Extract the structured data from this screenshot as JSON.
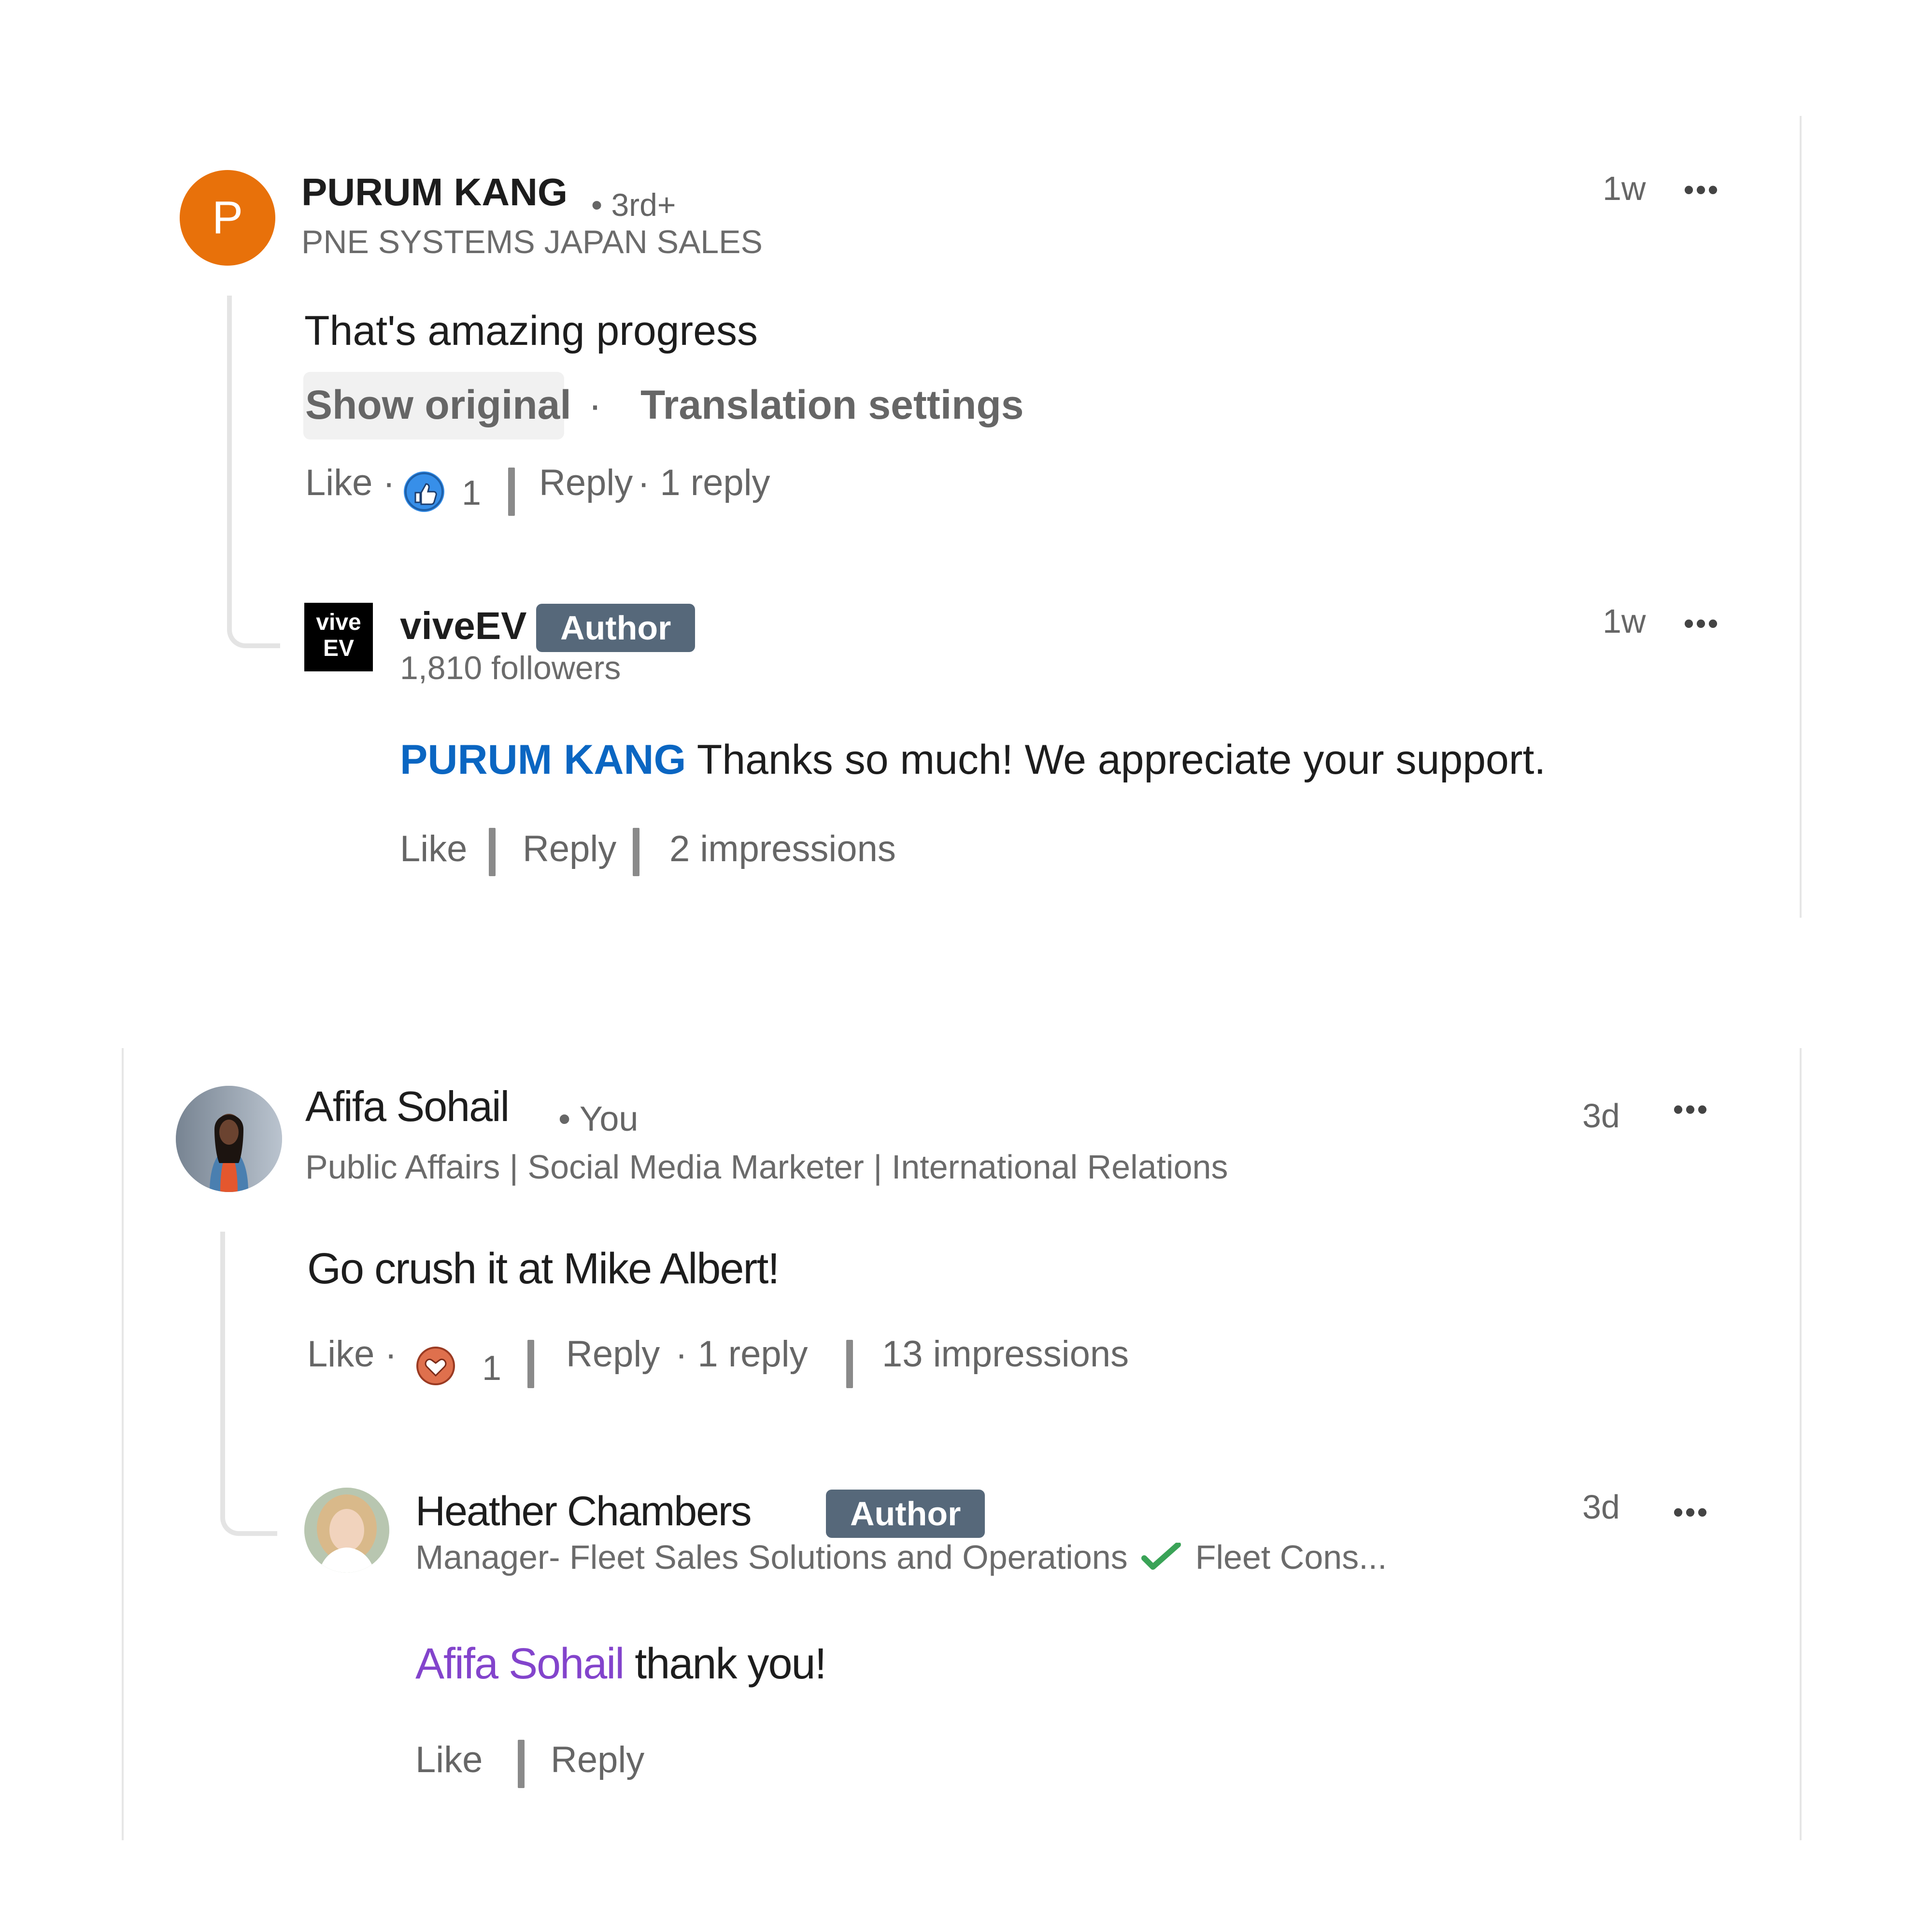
{
  "comment1": {
    "avatar_letter": "P",
    "name": "PURUM KANG",
    "degree": "• 3rd+",
    "headline": "PNE SYSTEMS JAPAN SALES",
    "time": "1w",
    "more": "•••",
    "text": "That's amazing progress",
    "show_original": "Show original",
    "dot": "·",
    "translation_settings": "Translation settings",
    "like": "Like ·",
    "reaction_icon": "thumbs-up-icon",
    "reaction_count": "1",
    "reply": "Reply",
    "replies": "· 1 reply"
  },
  "reply1": {
    "logo_line1": "vive",
    "logo_line2": "EV",
    "name": "viveEV",
    "badge": "Author",
    "followers": "1,810 followers",
    "time": "1w",
    "more": "•••",
    "mention": "PURUM KANG",
    "text": " Thanks so much! We appreciate your support.",
    "like": "Like",
    "reply": "Reply",
    "impressions": "2 impressions"
  },
  "comment2": {
    "name": "Afifa Sohail",
    "degree": "• You",
    "headline": "Public Affairs | Social Media Marketer | International Relations",
    "time": "3d",
    "more": "•••",
    "text": "Go crush it at Mike Albert!",
    "like": "Like ·",
    "reaction_icon": "heart-icon",
    "reaction_count": "1",
    "reply": "Reply",
    "replies": "· 1 reply",
    "impressions": "13 impressions"
  },
  "reply2": {
    "name": "Heather Chambers",
    "badge": "Author",
    "headline_part1": "Manager- Fleet Sales Solutions and Operations",
    "check_icon": "check-icon",
    "headline_part2": "Fleet Cons...",
    "time": "3d",
    "more": "•••",
    "mention": "Afifa Sohail",
    "text": " thank you!",
    "like": "Like",
    "reply": "Reply"
  },
  "colors": {
    "accent_orange": "#e8710a",
    "mention_blue": "#0a66c2",
    "mention_purple": "#8344cc",
    "badge_bg": "#56687a",
    "like_blue": "#378fe9",
    "heart_red": "#df704d"
  }
}
